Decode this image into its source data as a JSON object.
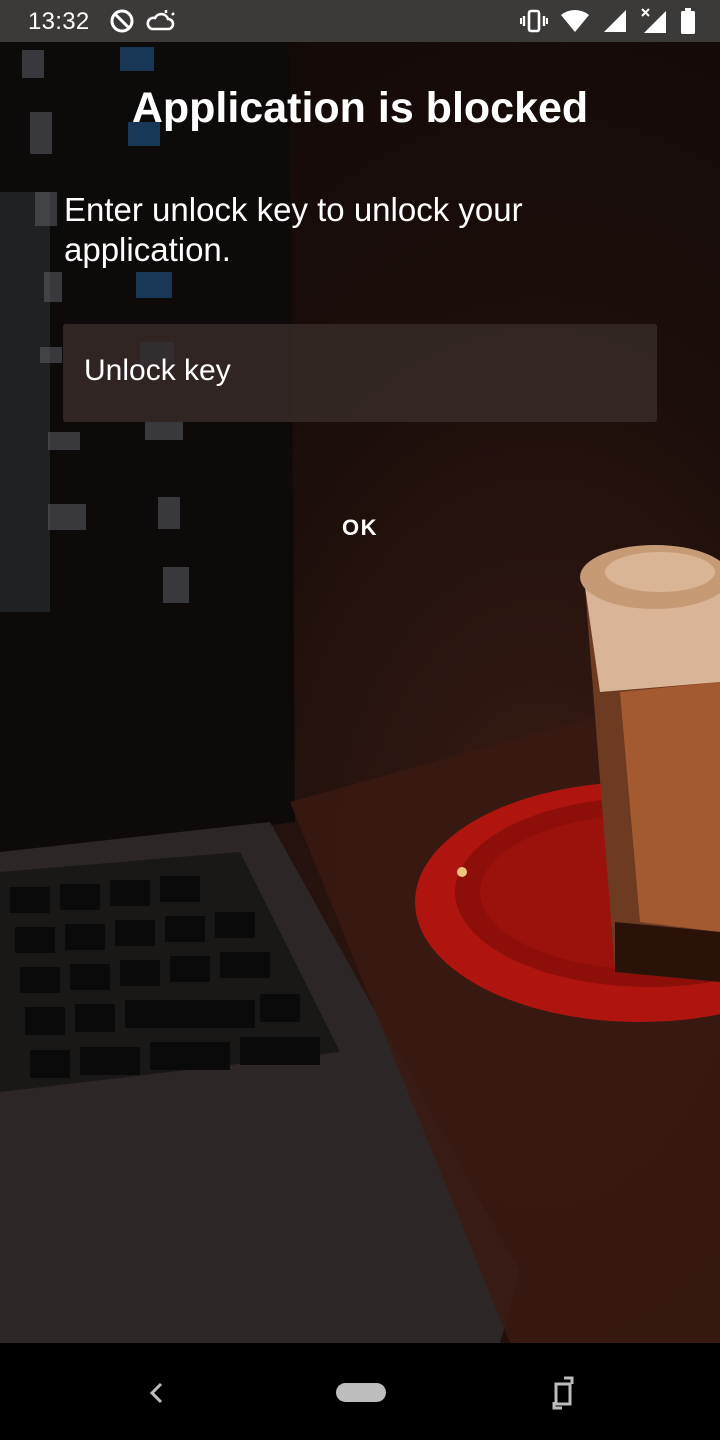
{
  "status_bar": {
    "time": "13:32",
    "left_icons": [
      "do-not-disturb-icon",
      "partly-cloudy-icon"
    ],
    "right_icons": [
      "vibrate-icon",
      "wifi-icon",
      "signal-icon",
      "signal-no-data-icon",
      "battery-icon"
    ]
  },
  "dialog": {
    "title": "Application is blocked",
    "message": "Enter unlock key to unlock your application.",
    "unlock_key_placeholder": "Unlock key",
    "unlock_key_value": "",
    "ok_label": "OK"
  },
  "nav_bar": {
    "icons": [
      "back-icon",
      "home-pill",
      "rotate-icon"
    ]
  },
  "colors": {
    "status_bar_bg": "#3c3a39",
    "text": "#ffffff",
    "input_bg": "#382c28",
    "saucer_red": "#b0140f"
  }
}
